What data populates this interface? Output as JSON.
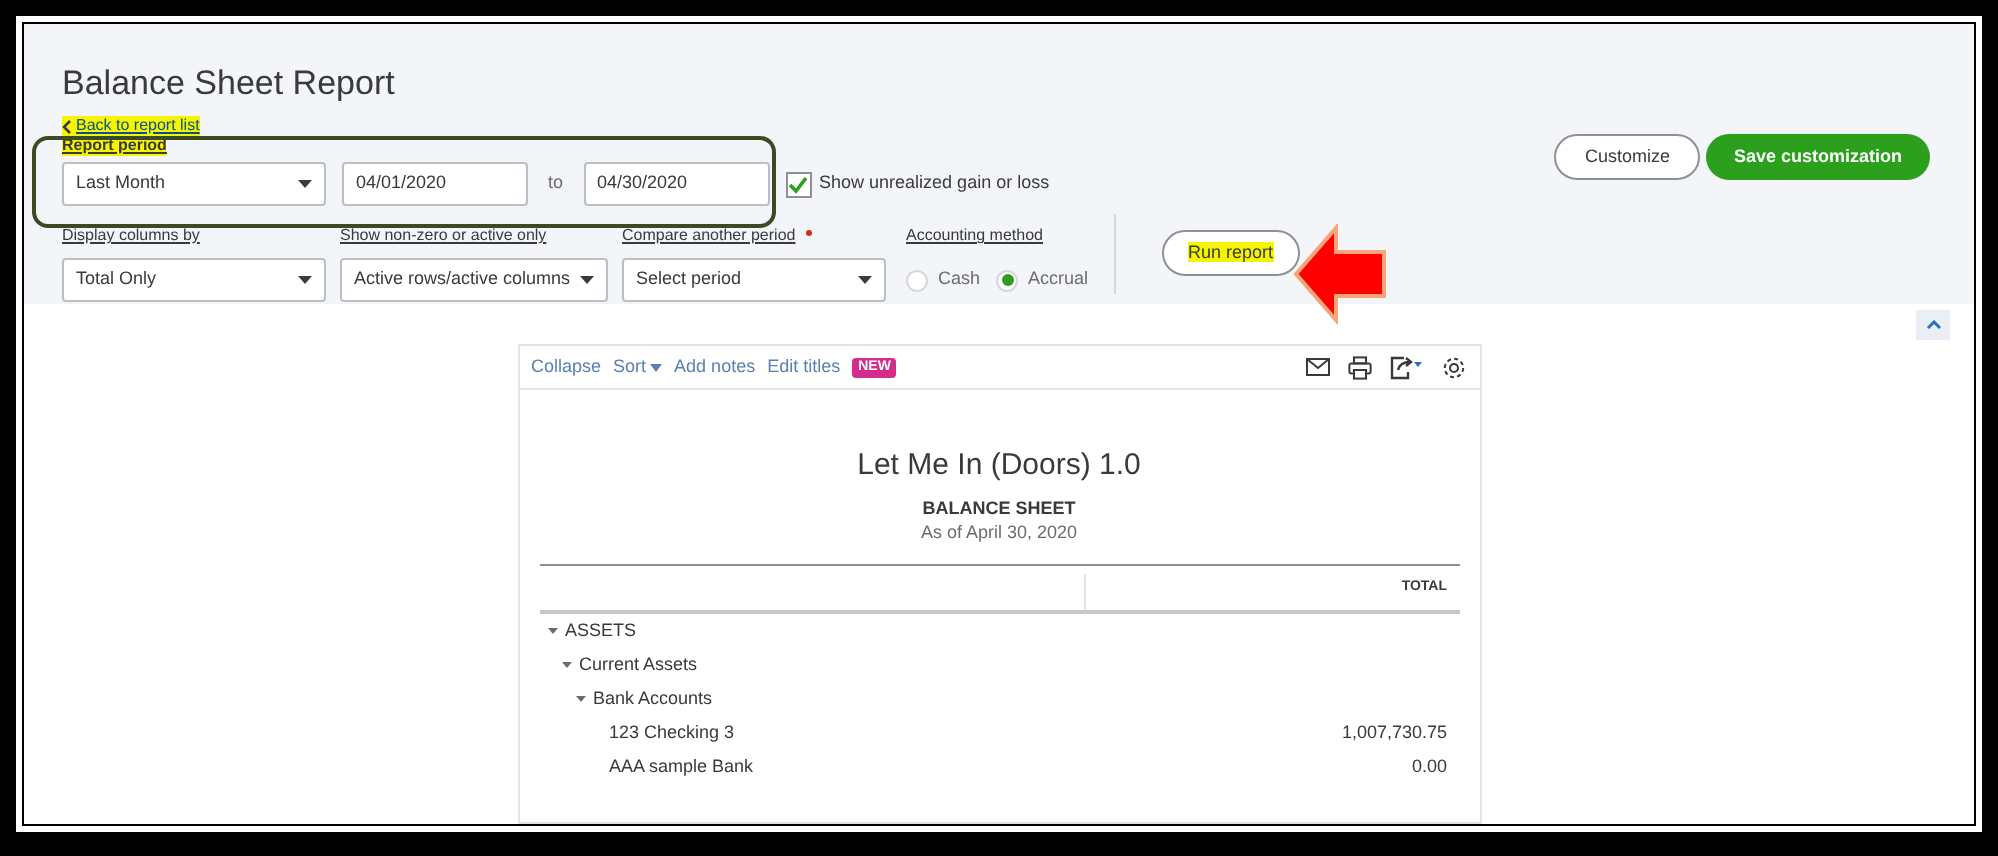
{
  "page_title": "Balance Sheet Report",
  "back_link": {
    "label": "Back to report list",
    "highlighted": true
  },
  "report_period": {
    "label": "Report period",
    "highlighted": true,
    "period": "Last Month",
    "from": "04/01/2020",
    "separator": "to",
    "to": "04/30/2020"
  },
  "show_unrealized": {
    "label": "Show unrealized gain or loss",
    "checked": true
  },
  "header_buttons": [
    {
      "label": "Customize",
      "kind": "outline"
    },
    {
      "label": "Save customization",
      "kind": "primary"
    }
  ],
  "filters": [
    {
      "label": "Display columns by",
      "value": "Total Only",
      "required": false
    },
    {
      "label": "Show non-zero or active only",
      "value": "Active rows/active columns",
      "required": false
    },
    {
      "label": "Compare another period",
      "value": "Select period",
      "required": true
    }
  ],
  "accounting_method": {
    "label": "Accounting method",
    "options": [
      {
        "label": "Cash",
        "selected": false
      },
      {
        "label": "Accrual",
        "selected": true
      }
    ]
  },
  "run_report": {
    "label": "Run report",
    "highlighted": true
  },
  "toolbar": {
    "links": [
      "Collapse",
      "Sort",
      "Add notes",
      "Edit titles"
    ],
    "badge": "NEW"
  },
  "report": {
    "company": "Let Me In (Doors) 1.0",
    "title": "BALANCE SHEET",
    "subtitle": "As of April 30, 2020",
    "column": "TOTAL",
    "rows": [
      {
        "label": "ASSETS",
        "expanded": true,
        "children": [
          {
            "label": "Current Assets",
            "expanded": true,
            "children": [
              {
                "label": "Bank Accounts",
                "expanded": true,
                "children": [
                  {
                    "label": "123 Checking 3",
                    "total": "1,007,730.75"
                  },
                  {
                    "label": "AAA sample Bank",
                    "total": "0.00"
                  }
                ]
              }
            ]
          }
        ]
      }
    ]
  }
}
